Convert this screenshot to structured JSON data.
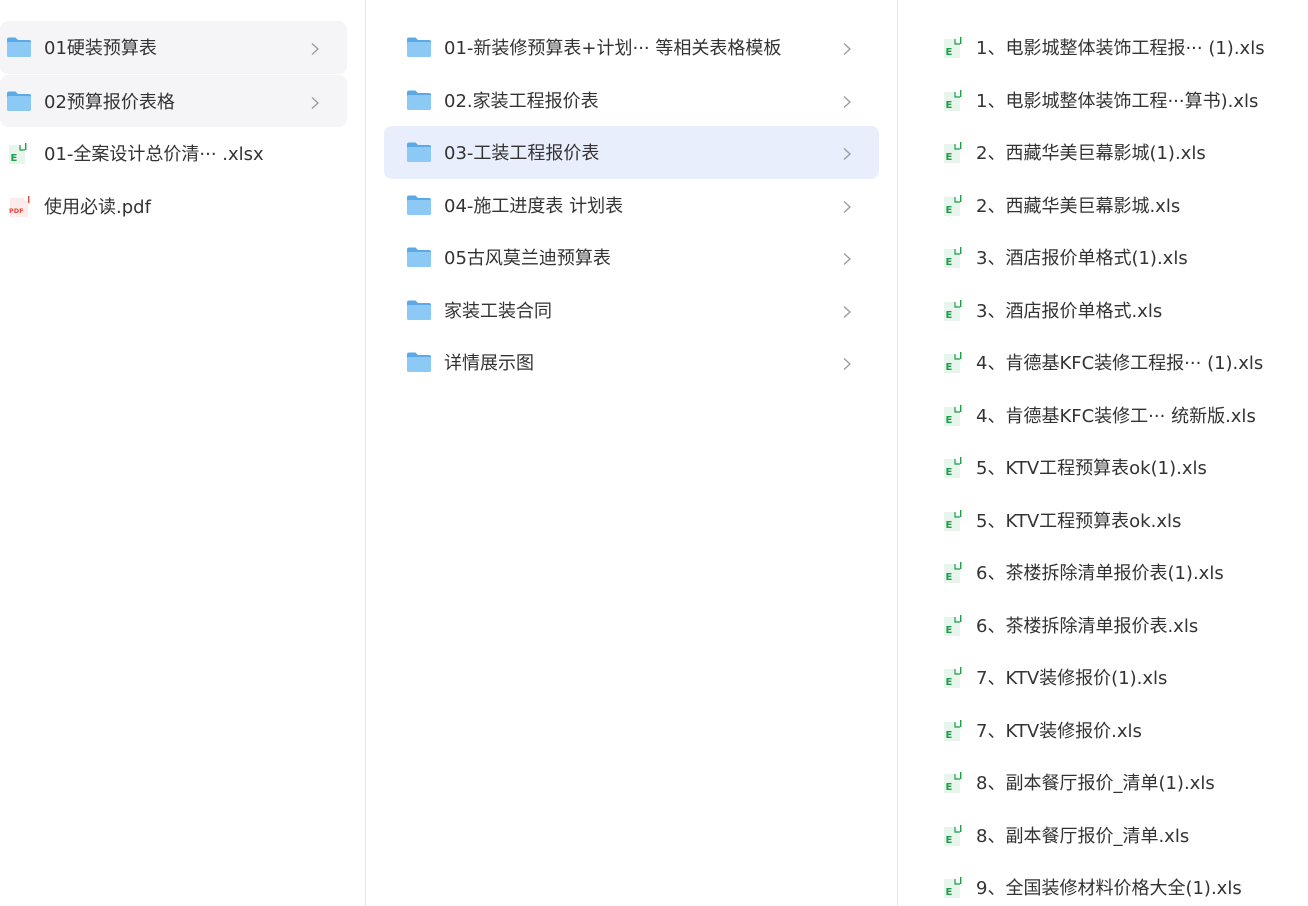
{
  "column1": {
    "items": [
      {
        "label": "01硬装预算表",
        "icon": "folder-icon",
        "has_children": true,
        "selected": true
      },
      {
        "label": "02预算报价表格",
        "icon": "folder-icon",
        "has_children": true,
        "selected": true
      },
      {
        "label": "01-全案设计总价清···    .xlsx",
        "icon": "excel-file-icon",
        "has_children": false,
        "selected": false
      },
      {
        "label": "使用必读.pdf",
        "icon": "pdf-file-icon",
        "has_children": false,
        "selected": false
      }
    ]
  },
  "column2": {
    "items": [
      {
        "label": "01-新装修预算表+计划···  等相关表格模板",
        "icon": "folder-icon",
        "has_children": true,
        "active": false
      },
      {
        "label": "02.家装工程报价表",
        "icon": "folder-icon",
        "has_children": true,
        "active": false
      },
      {
        "label": "03-工装工程报价表",
        "icon": "folder-icon",
        "has_children": true,
        "active": true
      },
      {
        "label": "04-施工进度表 计划表",
        "icon": "folder-icon",
        "has_children": true,
        "active": false
      },
      {
        "label": "05古风莫兰迪预算表",
        "icon": "folder-icon",
        "has_children": true,
        "active": false
      },
      {
        "label": "家装工装合同",
        "icon": "folder-icon",
        "has_children": true,
        "active": false
      },
      {
        "label": "详情展示图",
        "icon": "folder-icon",
        "has_children": true,
        "active": false
      }
    ]
  },
  "column3": {
    "items": [
      {
        "label": "1、电影城整体装饰工程报··· (1).xls",
        "icon": "excel-file-icon"
      },
      {
        "label": "1、电影城整体装饰工程···算书).xls",
        "icon": "excel-file-icon"
      },
      {
        "label": "2、西藏华美巨幕影城(1).xls",
        "icon": "excel-file-icon"
      },
      {
        "label": "2、西藏华美巨幕影城.xls",
        "icon": "excel-file-icon"
      },
      {
        "label": "3、酒店报价单格式(1).xls",
        "icon": "excel-file-icon"
      },
      {
        "label": "3、酒店报价单格式.xls",
        "icon": "excel-file-icon"
      },
      {
        "label": "4、肯德基KFC装修工程报··· (1).xls",
        "icon": "excel-file-icon"
      },
      {
        "label": "4、肯德基KFC装修工···  统新版.xls",
        "icon": "excel-file-icon"
      },
      {
        "label": "5、KTV工程预算表ok(1).xls",
        "icon": "excel-file-icon"
      },
      {
        "label": "5、KTV工程预算表ok.xls",
        "icon": "excel-file-icon"
      },
      {
        "label": "6、茶楼拆除清单报价表(1).xls",
        "icon": "excel-file-icon"
      },
      {
        "label": "6、茶楼拆除清单报价表.xls",
        "icon": "excel-file-icon"
      },
      {
        "label": "7、KTV装修报价(1).xls",
        "icon": "excel-file-icon"
      },
      {
        "label": "7、KTV装修报价.xls",
        "icon": "excel-file-icon"
      },
      {
        "label": "8、副本餐厅报价_清单(1).xls",
        "icon": "excel-file-icon"
      },
      {
        "label": "8、副本餐厅报价_清单.xls",
        "icon": "excel-file-icon"
      },
      {
        "label": "9、全国装修材料价格大全(1).xls",
        "icon": "excel-file-icon"
      }
    ]
  },
  "colors": {
    "folder": "#5aa9e8",
    "folder_light": "#8ccaf5",
    "excel": "#1f9e4a",
    "pdf": "#e04a3a",
    "selected_bg": "#f5f5f7",
    "active_bg": "#e9eefd",
    "text": "#333333",
    "chevron": "#9a9a9a"
  }
}
